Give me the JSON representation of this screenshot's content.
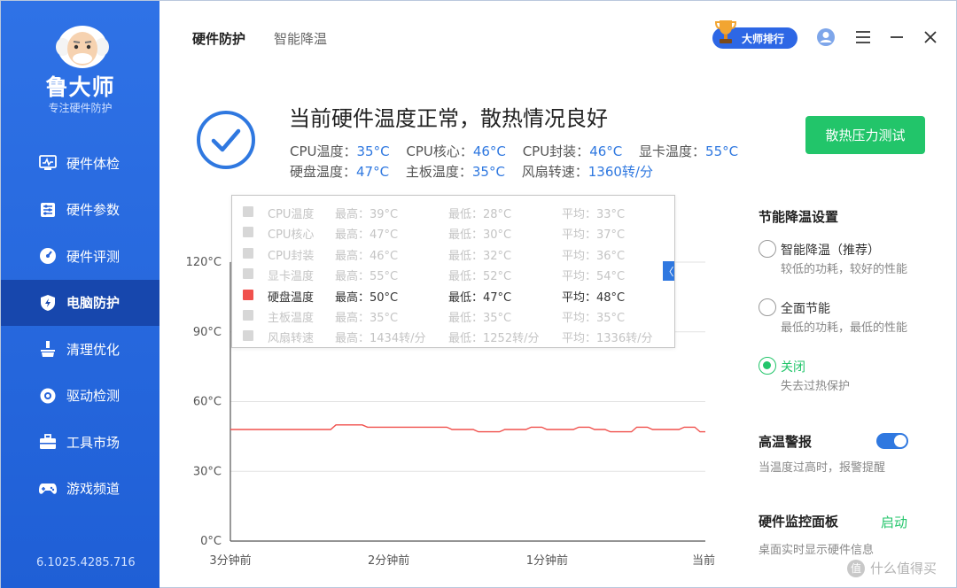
{
  "sidebar": {
    "brand": "鲁大师",
    "brand_sub": "专注硬件防护",
    "items": [
      {
        "label": "硬件体检",
        "icon": "monitor-pulse-icon"
      },
      {
        "label": "硬件参数",
        "icon": "sliders-icon"
      },
      {
        "label": "硬件评测",
        "icon": "gauge-icon"
      },
      {
        "label": "电脑防护",
        "icon": "shield-icon",
        "active": true
      },
      {
        "label": "清理优化",
        "icon": "broom-icon"
      },
      {
        "label": "驱动检测",
        "icon": "gear-icon"
      },
      {
        "label": "工具市场",
        "icon": "toolbox-icon"
      },
      {
        "label": "游戏频道",
        "icon": "gamepad-icon"
      }
    ],
    "version": "6.1025.4285.716"
  },
  "header": {
    "tabs": [
      {
        "label": "硬件防护",
        "active": true
      },
      {
        "label": "智能降温",
        "active": false
      }
    ],
    "rank_label": "大师排行",
    "icons": [
      "user-icon",
      "menu-icon",
      "minimize-icon",
      "close-icon"
    ]
  },
  "status": {
    "title": "当前硬件温度正常，散热情况良好",
    "line1": [
      {
        "label": "CPU温度：",
        "value": "35°C"
      },
      {
        "label": "CPU核心：",
        "value": "46°C"
      },
      {
        "label": "CPU封装：",
        "value": "46°C"
      },
      {
        "label": "显卡温度：",
        "value": "55°C"
      }
    ],
    "line2": [
      {
        "label": "硬盘温度：",
        "value": "47°C"
      },
      {
        "label": "主板温度：",
        "value": "35°C"
      },
      {
        "label": "风扇转速：",
        "value": "1360转/分"
      }
    ],
    "test_button": "散热压力测试"
  },
  "legend": {
    "rows": [
      {
        "name": "CPU温度",
        "max": "最高：39°C",
        "min": "最低：28°C",
        "avg": "平均：33°C",
        "on": false
      },
      {
        "name": "CPU核心",
        "max": "最高：47°C",
        "min": "最低：30°C",
        "avg": "平均：37°C",
        "on": false
      },
      {
        "name": "CPU封装",
        "max": "最高：46°C",
        "min": "最低：32°C",
        "avg": "平均：36°C",
        "on": false
      },
      {
        "name": "显卡温度",
        "max": "最高：55°C",
        "min": "最低：52°C",
        "avg": "平均：54°C",
        "on": false
      },
      {
        "name": "硬盘温度",
        "max": "最高：50°C",
        "min": "最低：47°C",
        "avg": "平均：48°C",
        "on": true
      },
      {
        "name": "主板温度",
        "max": "最高：35°C",
        "min": "最低：35°C",
        "avg": "平均：35°C",
        "on": false
      },
      {
        "name": "风扇转速",
        "max": "最高：1434转/分",
        "min": "最低：1252转/分",
        "avg": "平均：1336转/分",
        "on": false
      }
    ],
    "collapse_glyph": "〈"
  },
  "chart_data": {
    "type": "line",
    "x": [
      "3分钟前",
      "2分钟前",
      "1分钟前",
      "当前"
    ],
    "y_ticks": [
      "0°C",
      "30°C",
      "60°C",
      "90°C",
      "120°C"
    ],
    "ylim": [
      0,
      120
    ],
    "grid": true,
    "series": [
      {
        "name": "硬盘温度",
        "color": "#f0514d",
        "values": [
          48,
          48,
          48,
          48,
          48,
          48,
          48,
          48,
          48,
          48,
          48,
          48,
          48,
          48,
          48,
          48,
          48,
          48,
          48,
          48,
          50,
          50,
          50,
          50,
          50,
          50,
          49,
          49,
          49,
          49,
          49,
          49,
          49,
          49,
          49,
          49,
          49,
          49,
          49,
          49,
          49,
          49,
          48,
          48,
          48,
          48,
          48,
          47,
          47,
          47,
          47,
          47,
          48,
          48,
          48,
          48,
          48,
          49,
          49,
          49,
          48,
          48,
          48,
          48,
          48,
          48,
          49,
          49,
          49,
          48,
          48,
          48,
          47,
          47,
          47,
          47,
          47,
          49,
          49,
          49,
          48,
          48,
          48,
          48,
          48,
          48,
          49,
          49,
          49,
          47,
          47
        ]
      }
    ]
  },
  "settings": {
    "title": "节能降温设置",
    "options": [
      {
        "label": "智能降温（推荐）",
        "desc": "较低的功耗，较好的性能",
        "checked": false
      },
      {
        "label": "全面节能",
        "desc": "最低的功耗，最低的性能",
        "checked": false
      },
      {
        "label": "关闭",
        "desc": "失去过热保护",
        "checked": true
      }
    ],
    "alarm_title": "高温警报",
    "alarm_desc": "当温度过高时，报警提醒",
    "alarm_on": true,
    "panel_title": "硬件监控面板",
    "panel_action": "启动",
    "panel_desc": "桌面实时显示硬件信息"
  },
  "watermark": {
    "glyph": "值",
    "text": "什么值得买"
  }
}
